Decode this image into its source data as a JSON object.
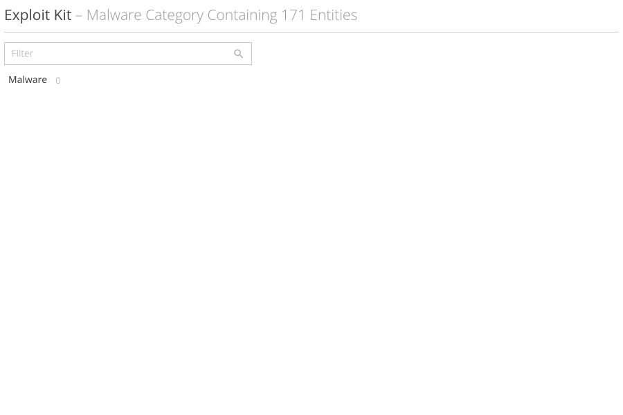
{
  "header": {
    "title": "Exploit Kit",
    "separator": " – ",
    "subtitle": "Malware Category Containing 171 Entities"
  },
  "filter": {
    "placeholder": "Filter",
    "value": ""
  },
  "row": {
    "label": "Malware",
    "count": "0"
  }
}
